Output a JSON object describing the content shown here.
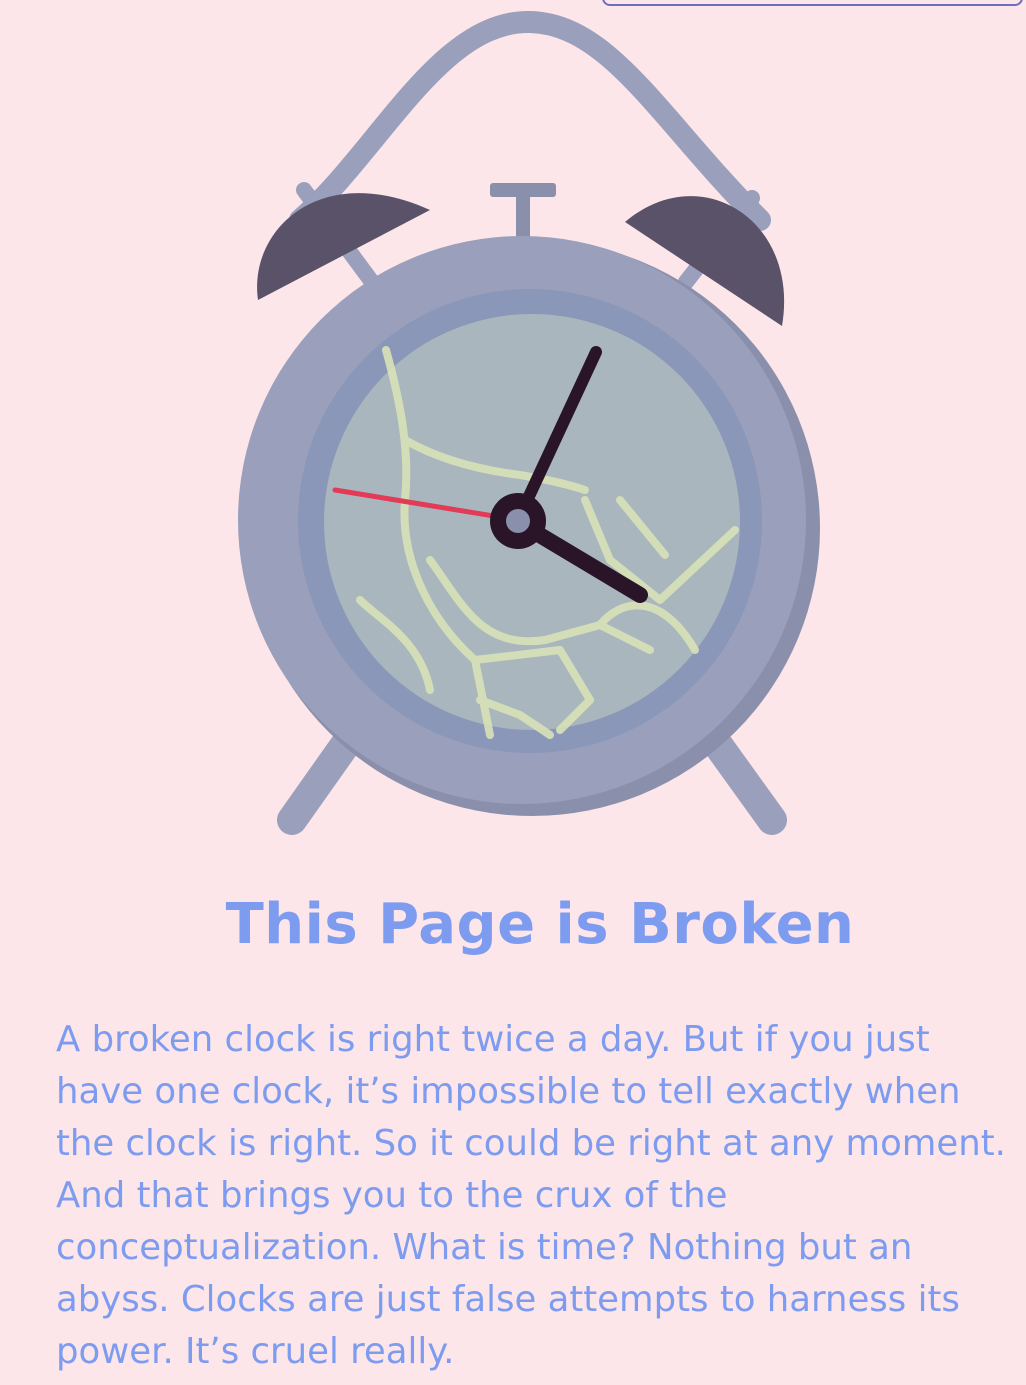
{
  "page": {
    "title": "This Page is Broken",
    "message": "A broken clock is right twice a day. But if you just have one clock, it’s impossible to tell exactly when the clock is right. So it could be right at any moment. And that brings you to the crux of the conceptualization. What is time? Nothing but an abyss. Clocks are just false attempts to harness its power. It’s cruel really."
  },
  "illustration": {
    "icon": "broken-alarm-clock-icon"
  },
  "colors": {
    "background": "#fde6ea",
    "heading_text": "#7d9cf0",
    "body_text": "#7d9cf0",
    "clock_body": "#9a9fbc",
    "clock_face": "#a9b6be",
    "bells": "#5a5269",
    "hands": "#2a1428",
    "second_hand": "#e23b57",
    "cracks": "#d8e2b8",
    "top_box_border": "#6b6fc2"
  }
}
